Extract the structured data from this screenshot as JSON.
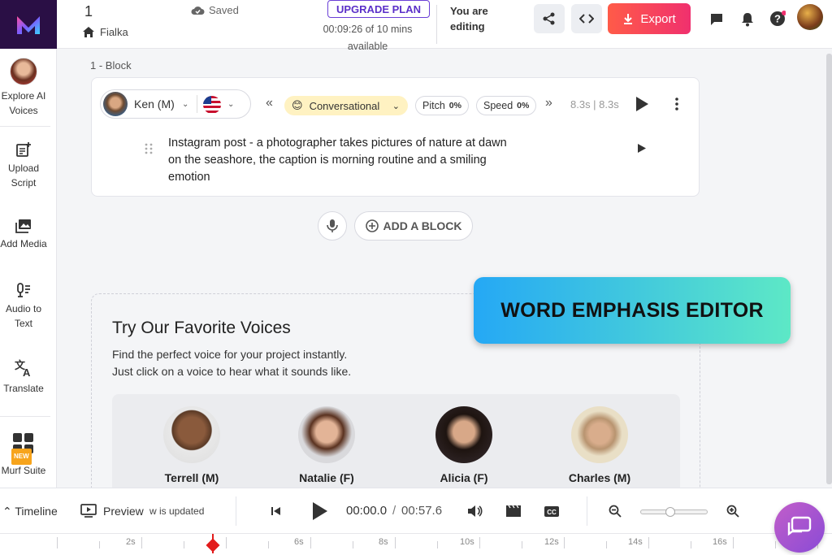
{
  "header": {
    "project_number": "1",
    "project_name": "Fialka",
    "save_status": "Saved",
    "upgrade_label": "UPGRADE PLAN",
    "time_used": "00:09:26 of 10 mins",
    "time_available": "available",
    "editing_line1": "You are",
    "editing_line2": "editing",
    "export_label": "Export"
  },
  "sidebar": {
    "items": [
      {
        "label1": "Explore AI",
        "label2": "Voices"
      },
      {
        "label1": "Upload",
        "label2": "Script"
      },
      {
        "label1": "Add Media",
        "label2": ""
      },
      {
        "label1": "Audio to",
        "label2": "Text"
      },
      {
        "label1": "Translate",
        "label2": ""
      },
      {
        "label1": "Murf Suite",
        "label2": "",
        "badge": "NEW"
      }
    ]
  },
  "block": {
    "label": "1 -  Block",
    "voice_name": "Ken (M)",
    "style": "Conversational",
    "pitch_label": "Pitch",
    "pitch_value": "0%",
    "speed_label": "Speed",
    "speed_value": "0%",
    "duration": "8.3s | 8.3s",
    "script_text": "Instagram post - a photographer takes pictures of nature at dawn on the seashore, the caption is morning routine and a smiling emotion"
  },
  "add_block_label": "ADD A BLOCK",
  "favorites": {
    "title": "Try Our Favorite Voices",
    "desc_line1": "Find the perfect voice for your project instantly.",
    "desc_line2": "Just click on a voice to hear what it sounds like.",
    "voices": [
      {
        "name": "Terrell (M)"
      },
      {
        "name": "Natalie (F)"
      },
      {
        "name": "Alicia (F)"
      },
      {
        "name": "Charles (M)"
      }
    ]
  },
  "banner_text": "WORD EMPHASIS EDITOR",
  "bottom": {
    "timeline_label": "Timeline",
    "preview_label": "Preview",
    "preview_note": "w is updated",
    "current_time": "00:00.0",
    "separator": "/",
    "total_time": "00:57.6"
  },
  "ruler": {
    "labels": [
      "2s",
      "6s",
      "8s",
      "10s",
      "12s",
      "14s",
      "16s"
    ]
  },
  "colors": {
    "brand": "#2a0f45",
    "export_start": "#ff5b48",
    "export_end": "#f0306e",
    "banner_start": "#25a8f5",
    "banner_end": "#5de8c6",
    "style_pill": "#fff2c2",
    "playhead": "#e21b1b"
  }
}
